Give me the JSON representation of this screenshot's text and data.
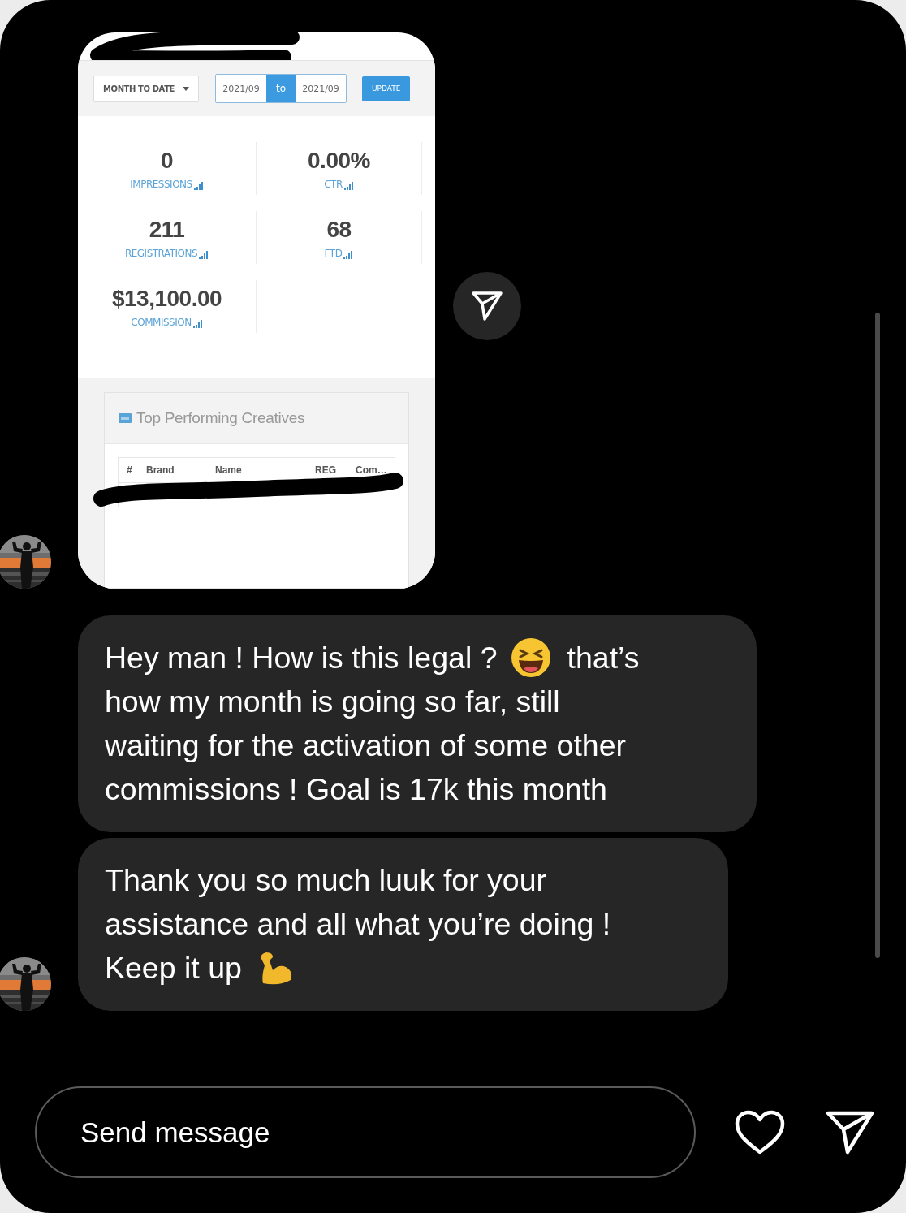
{
  "image_message": {
    "toolbar": {
      "range_select": "MONTH TO DATE",
      "date_from": "2021/09",
      "range_joiner": "to",
      "date_to": "2021/09",
      "update_button": "UPDATE"
    },
    "stats": [
      {
        "value": "0",
        "label": "IMPRESSIONS"
      },
      {
        "value": "0.00%",
        "label": "CTR"
      },
      {
        "value": "211",
        "label": "REGISTRATIONS"
      },
      {
        "value": "68",
        "label": "FTD"
      },
      {
        "value": "$13,100.00",
        "label": "COMMISSION"
      }
    ],
    "panel": {
      "title": "Top Performing Creatives",
      "columns": [
        "#",
        "Brand",
        "Name",
        "REG",
        "Com…"
      ]
    }
  },
  "messages": [
    {
      "lines": [
        [
          {
            "kind": "text",
            "text": "Hey man ! How is this legal ?"
          },
          {
            "kind": "laugh_emoji"
          },
          {
            "kind": "text",
            "text": "that’s"
          }
        ],
        [
          {
            "kind": "text",
            "text": "how my month is going so far, still"
          }
        ],
        [
          {
            "kind": "text",
            "text": "waiting for the activation of some other"
          }
        ],
        [
          {
            "kind": "text",
            "text": "commissions ! Goal is 17k this month"
          }
        ]
      ]
    },
    {
      "lines": [
        [
          {
            "kind": "text",
            "text": "Thank you so much luuk for your"
          }
        ],
        [
          {
            "kind": "text",
            "text": "assistance and all what you’re doing !"
          }
        ],
        [
          {
            "kind": "text",
            "text": "Keep it up"
          },
          {
            "kind": "flex_emoji"
          }
        ]
      ]
    }
  ],
  "composer": {
    "placeholder": "Send message"
  }
}
